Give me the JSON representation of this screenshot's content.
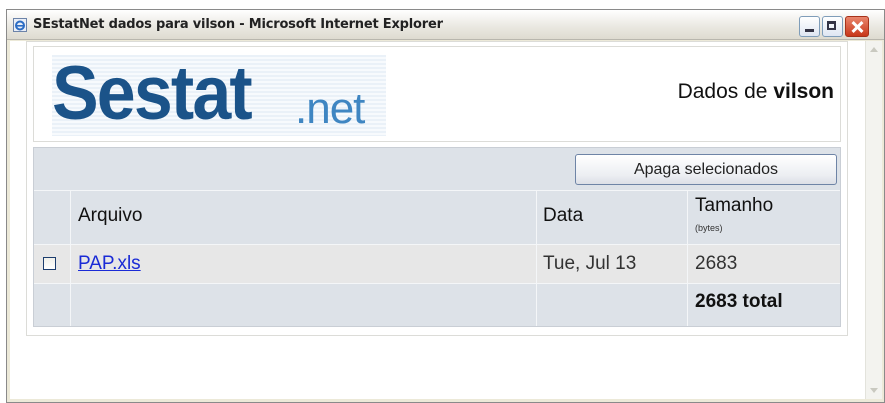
{
  "window": {
    "title": "SEstatNet dados para vilson - Microsoft Internet Explorer"
  },
  "header": {
    "logo_main": "Sestat",
    "logo_sub": ".net",
    "dados_prefix": "Dados de",
    "username": "vilson"
  },
  "toolbar": {
    "delete_selected_label": "Apaga selecionados"
  },
  "table": {
    "columns": {
      "file": "Arquivo",
      "date": "Data",
      "size": "Tamanho",
      "size_unit": "(bytes)"
    },
    "rows": [
      {
        "checked": false,
        "file": "PAP.xls",
        "date": "Tue, Jul 13",
        "size": "2683"
      }
    ],
    "total": "2683 total"
  },
  "colors": {
    "logo_dark": "#1b5389",
    "logo_light": "#3f86c2",
    "grid_bg": "#dde2e8",
    "link": "#1a2bd6"
  }
}
